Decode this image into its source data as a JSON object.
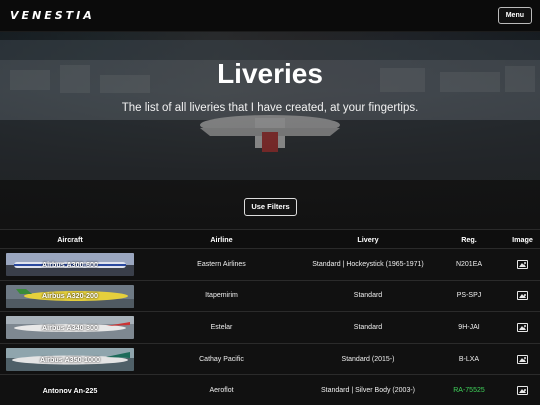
{
  "header": {
    "logo": "VENESTIA",
    "menu_label": "Menu"
  },
  "hero": {
    "title": "Liveries",
    "subtitle": "The list of all liveries that I have created, at your fingertips.",
    "filter_button": "Use Filters"
  },
  "table": {
    "columns": [
      "Aircraft",
      "Airline",
      "Livery",
      "Reg.",
      "Image"
    ],
    "rows": [
      {
        "aircraft": "Airbus A300-600",
        "airline": "Eastern Airlines",
        "livery": "Standard | Hockeystick (1965-1971)",
        "reg": "N201EA",
        "image_icon": "image-icon",
        "thumb_color": "#cfd4e6"
      },
      {
        "aircraft": "Airbus A320-200",
        "airline": "Itapemirim",
        "livery": "Standard",
        "reg": "PS-SPJ",
        "image_icon": "image-icon",
        "thumb_color": "#e8d24a"
      },
      {
        "aircraft": "Airbus A340-300",
        "airline": "Estelar",
        "livery": "Standard",
        "reg": "9H-JAI",
        "image_icon": "image-icon",
        "thumb_color": "#c9c9c9"
      },
      {
        "aircraft": "Airbus A350-1000",
        "airline": "Cathay Pacific",
        "livery": "Standard (2015-)",
        "reg": "B-LXA",
        "image_icon": "image-icon",
        "thumb_color": "#8fa8b0"
      },
      {
        "aircraft": "Antonov An-225",
        "airline": "Aeroflot",
        "livery": "Standard | Silver Body (2003-)",
        "reg": "RA-75525",
        "image_icon": "image-icon",
        "thumb_color": "",
        "reg_color": "#3fd35a"
      }
    ]
  }
}
